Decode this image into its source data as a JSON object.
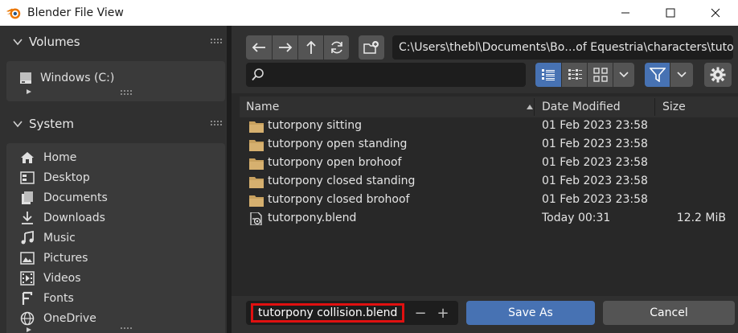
{
  "window": {
    "title": "Blender File View",
    "icon": "blender-logo-icon",
    "controls": [
      "minimize-icon",
      "maximize-icon",
      "close-icon"
    ]
  },
  "sidebar": {
    "volumes": {
      "header": "Volumes",
      "items": [
        {
          "label": "Windows (C:)",
          "icon": "drive-icon"
        }
      ]
    },
    "system": {
      "header": "System",
      "items": [
        {
          "label": "Home",
          "icon": "home-icon"
        },
        {
          "label": "Desktop",
          "icon": "desktop-icon"
        },
        {
          "label": "Documents",
          "icon": "documents-icon"
        },
        {
          "label": "Downloads",
          "icon": "downloads-icon"
        },
        {
          "label": "Music",
          "icon": "music-icon"
        },
        {
          "label": "Pictures",
          "icon": "pictures-icon"
        },
        {
          "label": "Videos",
          "icon": "videos-icon"
        },
        {
          "label": "Fonts",
          "icon": "fonts-icon"
        },
        {
          "label": "OneDrive",
          "icon": "globe-icon"
        }
      ]
    }
  },
  "toolbar": {
    "path": "C:\\Users\\thebl\\Documents\\Bo…of Equestria\\characters\\tutorial\\",
    "search_value": ""
  },
  "columns": {
    "name": "Name",
    "date": "Date Modified",
    "size": "Size"
  },
  "files": [
    {
      "name": "tutorpony sitting",
      "date": "01 Feb 2023 23:58",
      "size": "",
      "type": "folder"
    },
    {
      "name": "tutorpony open standing",
      "date": "01 Feb 2023 23:58",
      "size": "",
      "type": "folder"
    },
    {
      "name": "tutorpony open brohoof",
      "date": "01 Feb 2023 23:58",
      "size": "",
      "type": "folder"
    },
    {
      "name": "tutorpony closed standing",
      "date": "01 Feb 2023 23:58",
      "size": "",
      "type": "folder"
    },
    {
      "name": "tutorpony closed brohoof",
      "date": "01 Feb 2023 23:58",
      "size": "",
      "type": "folder"
    },
    {
      "name": "tutorpony.blend",
      "date": "Today 00:31",
      "size": "12.2 MiB",
      "type": "blend"
    }
  ],
  "footer": {
    "filename": "tutorpony collision.blend",
    "minus": "−",
    "plus": "+",
    "save_label": "Save As",
    "cancel_label": "Cancel"
  },
  "colors": {
    "accent": "#4772b3",
    "highlight_box": "#e01010",
    "folder": "#c8a15f"
  }
}
